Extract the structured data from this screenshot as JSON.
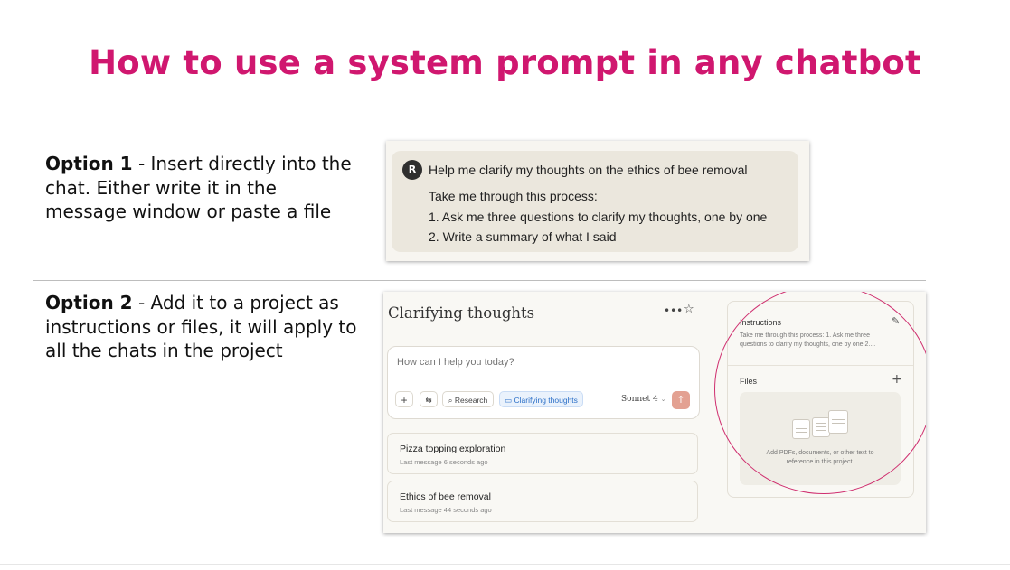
{
  "title": "How to use a system prompt in any chatbot",
  "option1": {
    "label": "Option 1",
    "text": " - Insert directly into the chat. Either write it in the message window or paste a file"
  },
  "option2": {
    "label": "Option 2",
    "text": " - Add it to a project as instructions or files, it will apply to all the chats in the project"
  },
  "chat_example": {
    "avatar_letter": "R",
    "lines": [
      "Help me clarify my thoughts on the ethics of bee removal",
      "Take me through this process:",
      "1. Ask me three questions to clarify my thoughts, one by one",
      "2. Write a summary of what I said"
    ]
  },
  "project": {
    "title": "Clarifying thoughts",
    "input_placeholder": "How can I help you today?",
    "toolbar": {
      "add": "+",
      "settings": "⇆",
      "research_label": "Research",
      "project_chip_label": "Clarifying thoughts",
      "model_label": "Sonnet 4",
      "send": "↑"
    },
    "chats": [
      {
        "title": "Pizza topping exploration",
        "subtitle": "Last message 6 seconds ago"
      },
      {
        "title": "Ethics of bee removal",
        "subtitle": "Last message 44 seconds ago"
      }
    ],
    "side_panel": {
      "instructions_label": "Instructions",
      "instructions_preview_line1": "Take me through this process: 1. Ask me three",
      "instructions_preview_line2": "questions to clarify my thoughts, one by one 2....",
      "files_label": "Files",
      "files_add": "+",
      "dropzone_line1": "Add PDFs, documents, or other text to",
      "dropzone_line2": "reference in this project."
    }
  },
  "colors": {
    "title": "#d0176f",
    "highlight_circle": "#cf2f6f",
    "send_button": "#e3a192"
  }
}
